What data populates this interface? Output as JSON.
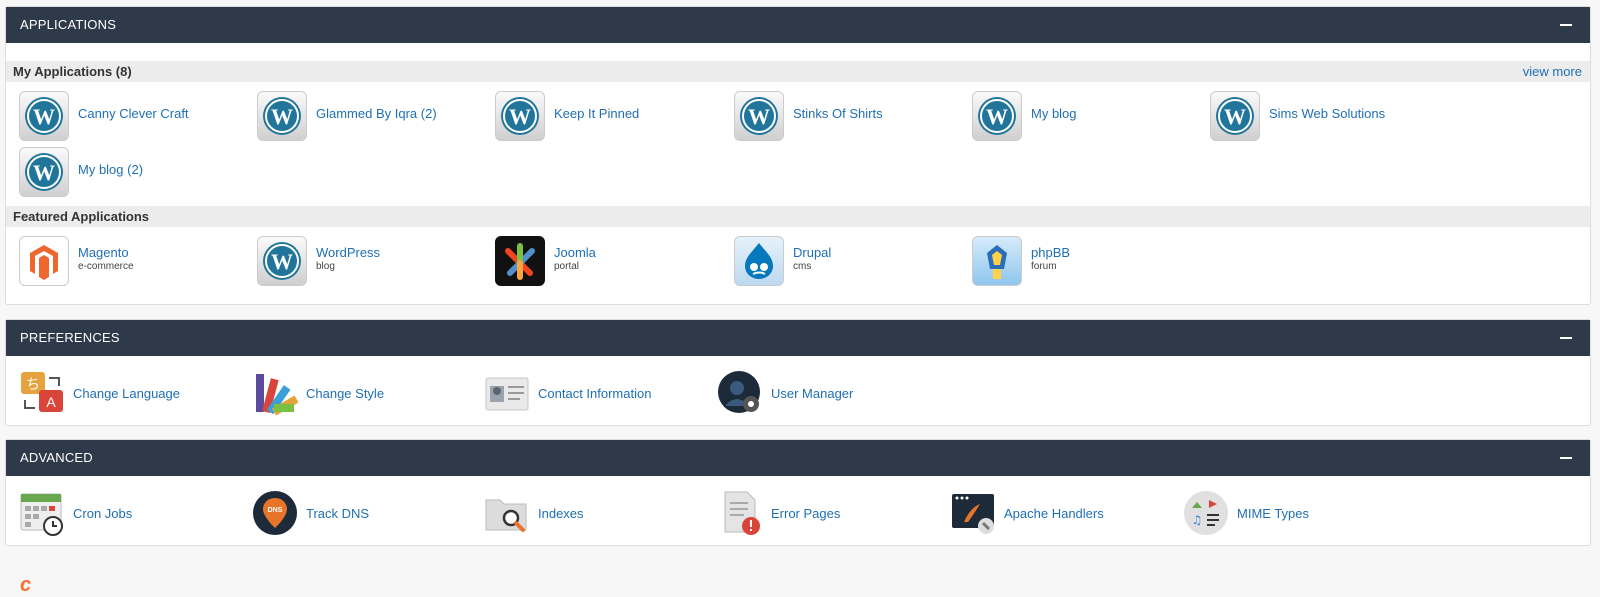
{
  "applications": {
    "title": "APPLICATIONS",
    "my_apps_label": "My Applications (8)",
    "view_more": "view more",
    "my_apps": [
      {
        "label": "Canny Clever Craft"
      },
      {
        "label": "Glammed By Iqra (2)"
      },
      {
        "label": "Keep It Pinned"
      },
      {
        "label": "Stinks Of Shirts"
      },
      {
        "label": "My blog"
      },
      {
        "label": "Sims Web Solutions"
      },
      {
        "label": "My blog (2)"
      }
    ],
    "featured_label": "Featured Applications",
    "featured": [
      {
        "label": "Magento",
        "sub": "e-commerce"
      },
      {
        "label": "WordPress",
        "sub": "blog"
      },
      {
        "label": "Joomla",
        "sub": "portal"
      },
      {
        "label": "Drupal",
        "sub": "cms"
      },
      {
        "label": "phpBB",
        "sub": "forum"
      }
    ]
  },
  "preferences": {
    "title": "PREFERENCES",
    "items": [
      {
        "label": "Change Language"
      },
      {
        "label": "Change Style"
      },
      {
        "label": "Contact Information"
      },
      {
        "label": "User Manager"
      }
    ]
  },
  "advanced": {
    "title": "ADVANCED",
    "items": [
      {
        "label": "Cron Jobs"
      },
      {
        "label": "Track DNS"
      },
      {
        "label": "Indexes"
      },
      {
        "label": "Error Pages"
      },
      {
        "label": "Apache Handlers"
      },
      {
        "label": "MIME Types"
      }
    ]
  },
  "colors": {
    "header_bg": "#2e3a4a",
    "link": "#1f6fb4",
    "wp_blue": "#21759b",
    "brand_orange": "#ff6c2c"
  }
}
